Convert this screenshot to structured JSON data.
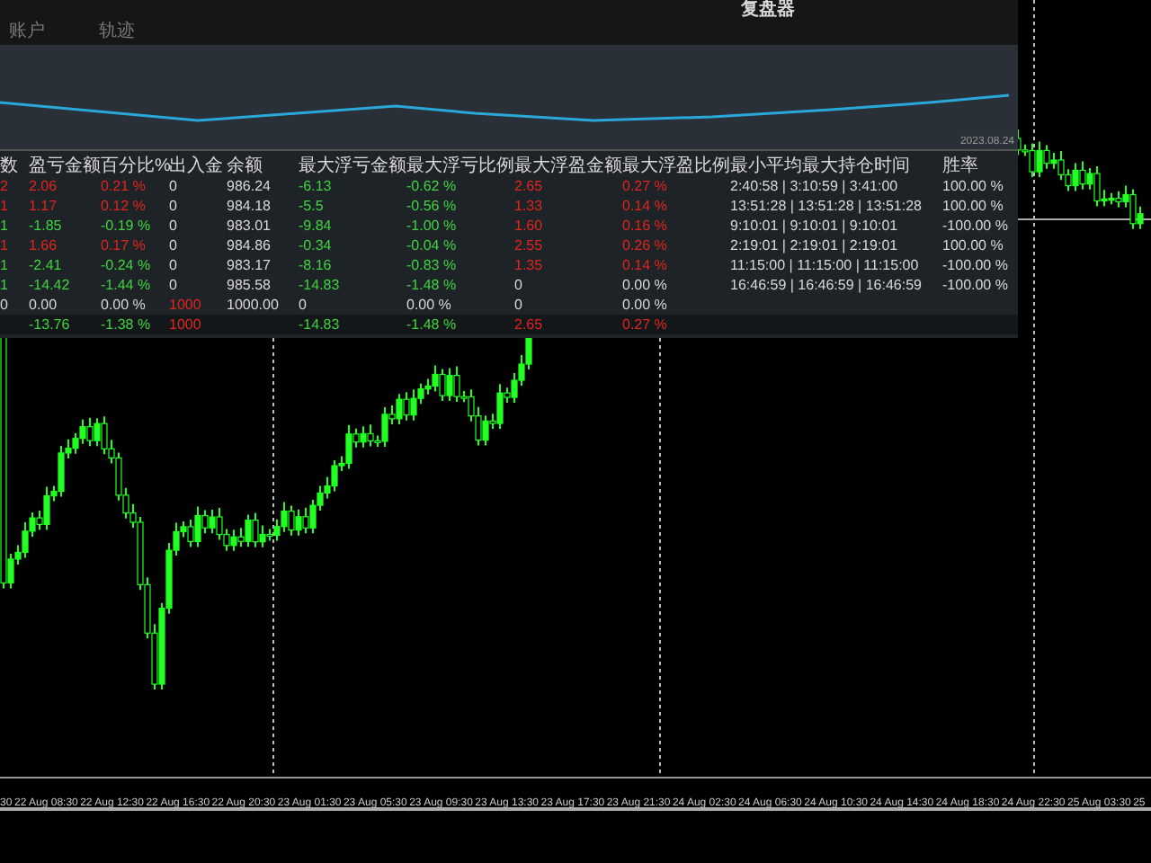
{
  "panel": {
    "title": "复盘器",
    "tabs": [
      {
        "label": "账户",
        "selected": false
      },
      {
        "label": "轨迹",
        "selected": false
      }
    ],
    "sparkline_date": "2023.08.24",
    "table": {
      "columns": [
        "数",
        "盈亏金额",
        "百分比%",
        "出入金",
        "余额",
        "最大浮亏金额",
        "最大浮亏比例",
        "最大浮盈金额",
        "最大浮盈比例",
        "最小平均最大持仓时间",
        "胜率"
      ],
      "rows": [
        {
          "kind": "data",
          "cells": [
            {
              "text": "2",
              "color": "#e0251f"
            },
            {
              "text": "2.06",
              "color": "#e0251f"
            },
            {
              "text": "0.21 %",
              "color": "#e0251f"
            },
            {
              "text": "0",
              "color": "#d8d8d8"
            },
            {
              "text": "986.24",
              "color": "#d8d8d8"
            },
            {
              "text": "-6.13",
              "color": "#3fd43f"
            },
            {
              "text": "-0.62 %",
              "color": "#3fd43f"
            },
            {
              "text": "2.65",
              "color": "#e0251f"
            },
            {
              "text": "0.27 %",
              "color": "#e0251f"
            },
            {
              "text": "2:40:58 | 3:10:59 | 3:41:00",
              "color": "#d8d8d8"
            },
            {
              "text": "100.00 %",
              "color": "#d8d8d8"
            }
          ]
        },
        {
          "kind": "data",
          "cells": [
            {
              "text": "1",
              "color": "#e0251f"
            },
            {
              "text": "1.17",
              "color": "#e0251f"
            },
            {
              "text": "0.12 %",
              "color": "#e0251f"
            },
            {
              "text": "0",
              "color": "#d8d8d8"
            },
            {
              "text": "984.18",
              "color": "#d8d8d8"
            },
            {
              "text": "-5.5",
              "color": "#3fd43f"
            },
            {
              "text": "-0.56 %",
              "color": "#3fd43f"
            },
            {
              "text": "1.33",
              "color": "#e0251f"
            },
            {
              "text": "0.14 %",
              "color": "#e0251f"
            },
            {
              "text": "13:51:28 | 13:51:28 | 13:51:28",
              "color": "#d8d8d8"
            },
            {
              "text": "100.00 %",
              "color": "#d8d8d8"
            }
          ]
        },
        {
          "kind": "data",
          "cells": [
            {
              "text": "1",
              "color": "#3fd43f"
            },
            {
              "text": "-1.85",
              "color": "#3fd43f"
            },
            {
              "text": "-0.19 %",
              "color": "#3fd43f"
            },
            {
              "text": "0",
              "color": "#d8d8d8"
            },
            {
              "text": "983.01",
              "color": "#d8d8d8"
            },
            {
              "text": "-9.84",
              "color": "#3fd43f"
            },
            {
              "text": "-1.00 %",
              "color": "#3fd43f"
            },
            {
              "text": "1.60",
              "color": "#e0251f"
            },
            {
              "text": "0.16 %",
              "color": "#e0251f"
            },
            {
              "text": "9:10:01 | 9:10:01 | 9:10:01",
              "color": "#d8d8d8"
            },
            {
              "text": "-100.00 %",
              "color": "#d8d8d8"
            }
          ]
        },
        {
          "kind": "data",
          "cells": [
            {
              "text": "1",
              "color": "#e0251f"
            },
            {
              "text": "1.66",
              "color": "#e0251f"
            },
            {
              "text": "0.17 %",
              "color": "#e0251f"
            },
            {
              "text": "0",
              "color": "#d8d8d8"
            },
            {
              "text": "984.86",
              "color": "#d8d8d8"
            },
            {
              "text": "-0.34",
              "color": "#3fd43f"
            },
            {
              "text": "-0.04 %",
              "color": "#3fd43f"
            },
            {
              "text": "2.55",
              "color": "#e0251f"
            },
            {
              "text": "0.26 %",
              "color": "#e0251f"
            },
            {
              "text": "2:19:01 | 2:19:01 | 2:19:01",
              "color": "#d8d8d8"
            },
            {
              "text": "100.00 %",
              "color": "#d8d8d8"
            }
          ]
        },
        {
          "kind": "data",
          "cells": [
            {
              "text": "1",
              "color": "#3fd43f"
            },
            {
              "text": "-2.41",
              "color": "#3fd43f"
            },
            {
              "text": "-0.24 %",
              "color": "#3fd43f"
            },
            {
              "text": "0",
              "color": "#d8d8d8"
            },
            {
              "text": "983.17",
              "color": "#d8d8d8"
            },
            {
              "text": "-8.16",
              "color": "#3fd43f"
            },
            {
              "text": "-0.83 %",
              "color": "#3fd43f"
            },
            {
              "text": "1.35",
              "color": "#e0251f"
            },
            {
              "text": "0.14 %",
              "color": "#e0251f"
            },
            {
              "text": "11:15:00 | 11:15:00 | 11:15:00",
              "color": "#d8d8d8"
            },
            {
              "text": "-100.00 %",
              "color": "#d8d8d8"
            }
          ]
        },
        {
          "kind": "data",
          "cells": [
            {
              "text": "1",
              "color": "#3fd43f"
            },
            {
              "text": "-14.42",
              "color": "#3fd43f"
            },
            {
              "text": "-1.44 %",
              "color": "#3fd43f"
            },
            {
              "text": "0",
              "color": "#d8d8d8"
            },
            {
              "text": "985.58",
              "color": "#d8d8d8"
            },
            {
              "text": "-14.83",
              "color": "#3fd43f"
            },
            {
              "text": "-1.48 %",
              "color": "#3fd43f"
            },
            {
              "text": "0",
              "color": "#d8d8d8"
            },
            {
              "text": "0.00 %",
              "color": "#d8d8d8"
            },
            {
              "text": "16:46:59 | 16:46:59 | 16:46:59",
              "color": "#d8d8d8"
            },
            {
              "text": "-100.00 %",
              "color": "#d8d8d8"
            }
          ]
        },
        {
          "kind": "data",
          "cells": [
            {
              "text": "0",
              "color": "#d8d8d8"
            },
            {
              "text": "0.00",
              "color": "#d8d8d8"
            },
            {
              "text": "0.00 %",
              "color": "#d8d8d8"
            },
            {
              "text": "1000",
              "color": "#e0251f"
            },
            {
              "text": "1000.00",
              "color": "#d8d8d8"
            },
            {
              "text": "0",
              "color": "#d8d8d8"
            },
            {
              "text": "0.00 %",
              "color": "#d8d8d8"
            },
            {
              "text": "0",
              "color": "#d8d8d8"
            },
            {
              "text": "0.00 %",
              "color": "#d8d8d8"
            },
            null,
            null
          ]
        },
        {
          "kind": "total",
          "cells": [
            null,
            {
              "text": "-13.76",
              "color": "#3fd43f"
            },
            {
              "text": "-1.38 %",
              "color": "#3fd43f"
            },
            {
              "text": "1000",
              "color": "#e0251f"
            },
            null,
            {
              "text": "-14.83",
              "color": "#3fd43f"
            },
            {
              "text": "-1.48 %",
              "color": "#3fd43f"
            },
            {
              "text": "2.65",
              "color": "#e0251f"
            },
            {
              "text": "0.27 %",
              "color": "#e0251f"
            },
            null,
            null
          ]
        }
      ]
    }
  },
  "time_axis": {
    "labels": [
      "30",
      "22 Aug 08:30",
      "22 Aug 12:30",
      "22 Aug 16:30",
      "22 Aug 20:30",
      "23 Aug 01:30",
      "23 Aug 05:30",
      "23 Aug 09:30",
      "23 Aug 13:30",
      "23 Aug 17:30",
      "23 Aug 21:30",
      "24 Aug 02:30",
      "24 Aug 06:30",
      "24 Aug 10:30",
      "24 Aug 14:30",
      "24 Aug 18:30",
      "24 Aug 22:30",
      "25 Aug 03:30",
      "25"
    ]
  }
}
